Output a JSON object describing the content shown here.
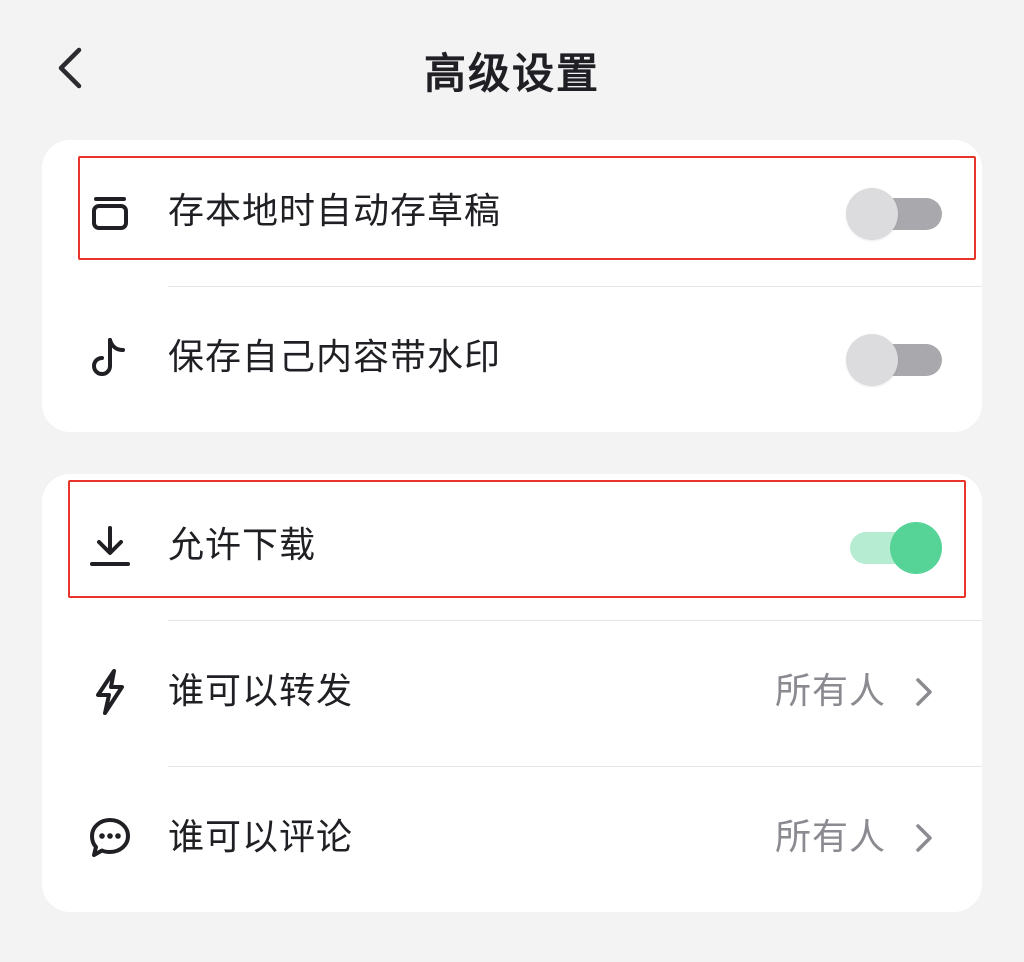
{
  "header": {
    "title": "高级设置",
    "back_icon": "chevron-left-icon"
  },
  "card1": {
    "rows": [
      {
        "label": "存本地时自动存草稿",
        "icon": "draft-box-icon",
        "toggle": "off"
      },
      {
        "label": "保存自己内容带水印",
        "icon": "tiktok-note-icon",
        "toggle": "off"
      }
    ]
  },
  "card2": {
    "rows": [
      {
        "label": "允许下载",
        "icon": "download-icon",
        "toggle": "on"
      },
      {
        "label": "谁可以转发",
        "icon": "lightning-icon",
        "value": "所有人"
      },
      {
        "label": "谁可以评论",
        "icon": "comment-icon",
        "value": "所有人"
      }
    ]
  },
  "colors": {
    "background": "#f3f3f4",
    "card": "#ffffff",
    "toggle_on": "#56d497",
    "toggle_off": "#a9a9ad",
    "highlight": "#e8352b"
  }
}
